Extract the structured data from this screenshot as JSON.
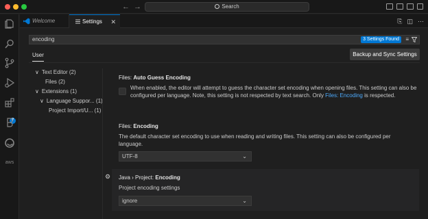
{
  "titlebar": {
    "command_center": "Search",
    "back": "←",
    "forward": "→"
  },
  "tabs": [
    {
      "label": "Welcome",
      "icon": "vscode-logo-icon"
    },
    {
      "label": "Settings",
      "icon": "settings-list-icon",
      "close": "✕"
    }
  ],
  "search": {
    "value": "encoding",
    "found": "3 Settings Found"
  },
  "scope": {
    "user_tab": "User",
    "sync_button": "Backup and Sync Settings"
  },
  "toc": [
    {
      "label": "Text Editor (2)",
      "arrow": "∨"
    },
    {
      "label": "Files (2)"
    },
    {
      "label": "Extensions (1)",
      "arrow": "∨"
    },
    {
      "label": "Language Suppor... (1)",
      "arrow": "∨"
    },
    {
      "label": "Project Import/U... (1)"
    }
  ],
  "settings": {
    "auto_guess": {
      "prefix": "Files: ",
      "name": "Auto Guess Encoding",
      "desc_before": "When enabled, the editor will attempt to guess the character set encoding when opening files. This setting can also be configured per language. Note, this setting is not respected by text search. Only ",
      "desc_link": "Files: Encoding",
      "desc_after": " is respected."
    },
    "encoding": {
      "prefix": "Files: ",
      "name": "Encoding",
      "desc": "The default character set encoding to use when reading and writing files. This setting can also be configured per language.",
      "value": "UTF-8"
    },
    "java_encoding": {
      "prefix": "Java › Project: ",
      "name": "Encoding",
      "desc": "Project encoding settings",
      "value": "ignore"
    }
  },
  "activity_badge": "7",
  "activity_aws_label": "aws"
}
